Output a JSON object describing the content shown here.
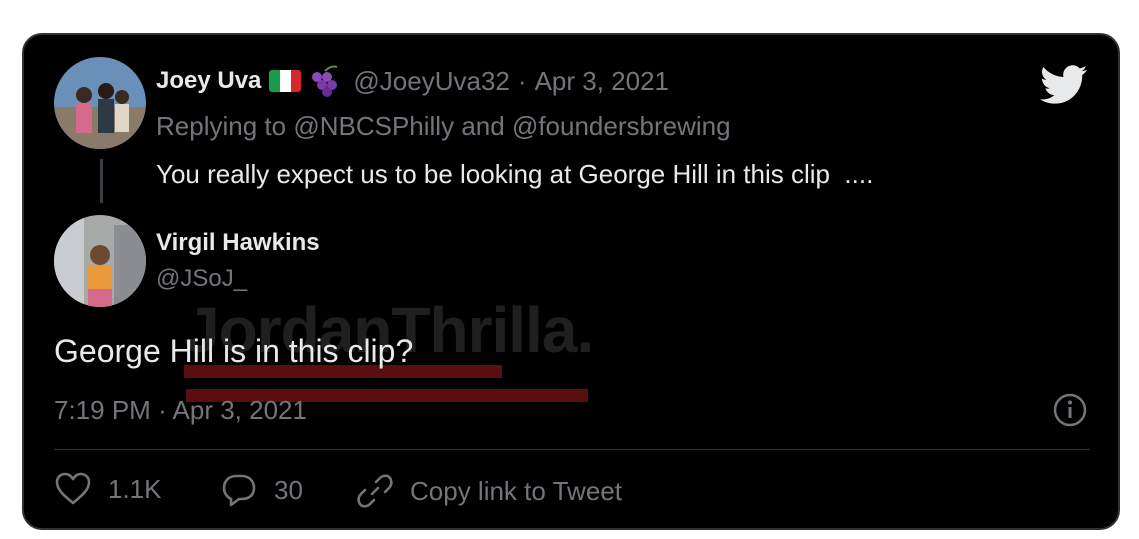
{
  "reply_tweet": {
    "display_name": "Joey Uva",
    "handle": "@JoeyUva32",
    "separator": "·",
    "date": "Apr 3, 2021",
    "replying_prefix": "Replying to",
    "mention_1": "@NBCSPhilly",
    "and_word": "and",
    "mention_2": "@foundersbrewing",
    "text": "You really expect us to be looking at George Hill in this clip  ...."
  },
  "main_tweet": {
    "display_name": "Virgil Hawkins",
    "handle": "@JSoJ_",
    "text": "George Hill is in this clip?",
    "time": "7:19 PM",
    "separator": "·",
    "date": "Apr 3, 2021"
  },
  "watermark": "JordanThrilla.",
  "actions": {
    "like_count": "1.1K",
    "reply_count": "30",
    "copy_link_label": "Copy link to Tweet"
  },
  "colors": {
    "background": "#000000",
    "text_primary": "#e7e9ea",
    "text_muted": "#71767b",
    "border": "#2f3336",
    "watermark_bar": "#5a0e0e"
  }
}
